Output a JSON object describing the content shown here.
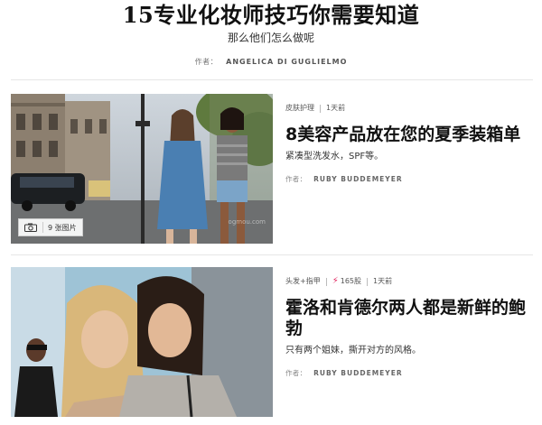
{
  "hero": {
    "title": "15专业化妆师技巧你需要知道",
    "subtitle": "那么他们怎么做呢",
    "byline_label": "作者：",
    "author": "ANGELICA DI GUGLIELMO"
  },
  "articles": [
    {
      "category": "皮肤护理",
      "time": "1天前",
      "headline": "8美容产品放在您的夏季装箱单",
      "summary": "紧凑型洗发水，SPF等。",
      "byline_label": "作者：",
      "author": "RUBY BUDDEMEYER",
      "photo_count": "9 张图片",
      "watermark": "ogmou.com"
    },
    {
      "category": "头发+指甲",
      "shares": "165股",
      "time": "1天前",
      "headline": "霍洛和肯德尔两人都是新鲜的鲍勃",
      "summary": "只有两个姐妹，撕开对方的风格。",
      "byline_label": "作者：",
      "author": "RUBY BUDDEMEYER"
    }
  ],
  "icons": {
    "camera": "camera-icon",
    "share_bolt": "lightning-bolt-icon"
  },
  "colors": {
    "accent": "#e0245e",
    "text": "#111111",
    "muted": "#888888"
  }
}
